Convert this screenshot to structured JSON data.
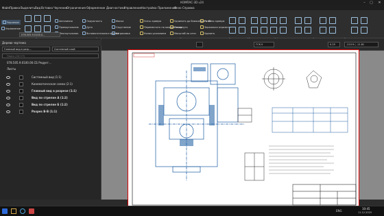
{
  "window": {
    "title": "КОМПАС-3D v24",
    "btn_min": "–",
    "btn_max": "▢",
    "btn_close": "✕"
  },
  "menu": [
    "Файл",
    "Правка",
    "Выделить",
    "Вид",
    "Вставка",
    "Черчение",
    "Ограничения",
    "Оформление",
    "Диагностика",
    "Управление",
    "Настройка",
    "Приложения",
    "Окно",
    "Справка"
  ],
  "ribbon": {
    "left": [
      "Черчение",
      "Управление"
    ],
    "col1": [
      "Автолиния",
      "Прямоугольник",
      "Многоугольник"
    ],
    "col2": [
      "Окружность",
      "Дуга",
      "Вспомогательная прямая"
    ],
    "col3": [
      "Фаска",
      "Скругление",
      "Штриховка"
    ],
    "col4": [
      "Усечь кривую",
      "Переместить по координатам",
      "Копия указанием"
    ],
    "col5": [
      "Удлинить до ближайшего об...",
      "Повернуть",
      "Масштаб по сети"
    ],
    "col6": [
      "Разбить кривую",
      "Зеркально отразить",
      "Удалить"
    ],
    "groups": [
      "Системная",
      "Геометрия",
      "Правка",
      "Разм...",
      "Обозначения",
      "Оформление",
      "Элементы о...",
      "Вставка"
    ]
  },
  "tree": {
    "title": "Дерево чертежа",
    "dropdown1": "Главный вид в разр...",
    "dropdown2": "Системный слой",
    "search_placeholder": "Поиск (Ctrl+F)",
    "root": "078.505.9.0100.00.СБ Редукт...",
    "sheets": "Листы",
    "items": [
      "Системный вид (1:1)",
      "Кинематическая схема (2:1)",
      "Главный вид в разрезе (1:1)",
      "Вид по стрелке А (1:2)",
      "Вид по стрелке Б (1:2)",
      "Разрез В-В (1:1)"
    ]
  },
  "canvas_toolbar": {
    "layer": "ГСК 0",
    "zoom": "0.25",
    "coords": "-210.9 ( -11.81"
  },
  "tab": "078.505.9.0100.0...",
  "taskbar": {
    "time": "10:45",
    "date": "11.12.2025",
    "lang": "ENG"
  }
}
